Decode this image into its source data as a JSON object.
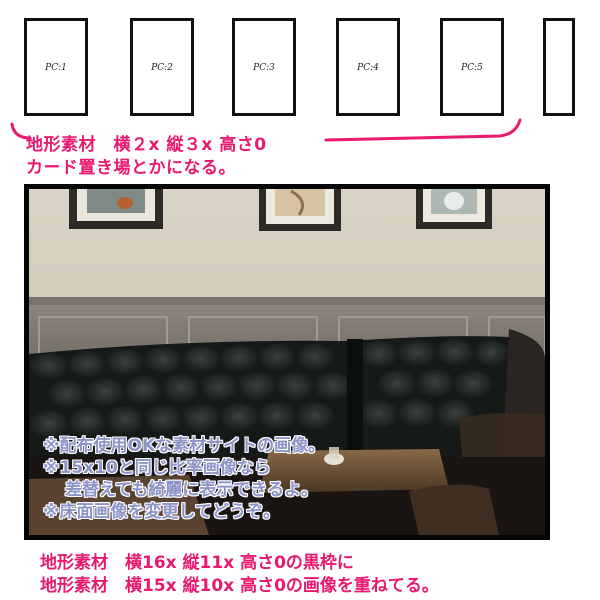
{
  "cards": [
    {
      "label": "PC:1"
    },
    {
      "label": "PC:2"
    },
    {
      "label": "PC:3"
    },
    {
      "label": "PC:4"
    },
    {
      "label": "PC:5"
    }
  ],
  "top_caption": {
    "line1": "地形素材　横２x 縦３x 高さ0",
    "line2": "カード置き場とかになる。"
  },
  "photo_notes": {
    "line1": "※配布使用OKな素材サイトの画像。",
    "line2": "※15x10と同じ比率画像なら",
    "line3": "差替えても綺麗に表示できるよ。",
    "line4": "※床面画像を変更してどうぞ。"
  },
  "bottom_caption": {
    "line1": "地形素材　横16x 縦11x 高さ0の黒枠に",
    "line2": "地形素材　横15x 縦10x 高さ0の画像を重ねてる。"
  },
  "colors": {
    "accent": "#e8196e",
    "note_text": "#8d94c8",
    "frame": "#050505"
  }
}
